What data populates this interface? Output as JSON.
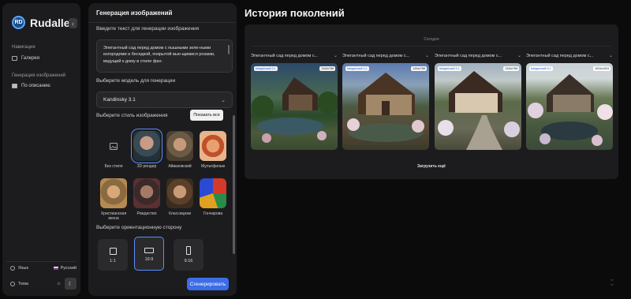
{
  "app": {
    "name": "Rudalle",
    "logo_letters": "RD"
  },
  "sidebar": {
    "collapse_icon": "chevron-left-icon",
    "nav_section": "Навигация",
    "nav_items": [
      {
        "label": "Галерея",
        "icon": "gallery-icon"
      }
    ],
    "gen_section": "Генерация изображений",
    "gen_items": [
      {
        "label": "По описанию",
        "icon": "text-image-icon",
        "active": true
      }
    ],
    "language_label": "Язык",
    "language_value": "Русский",
    "theme_label": "Тема"
  },
  "panel": {
    "title": "Генерация изображений",
    "prompt_label": "Введите текст для генерации изображения",
    "prompt_value": "Элегантный сад перед домом с пышными зеле-ными изгородями и беседкой, покрытой вью-щимися розами, ведущий к  дому в стиле фах-",
    "model_label": "Выберите модель для генерации",
    "model_value": "Kandinsky 3.1",
    "style_label": "Выберите стиль изображения",
    "show_all": "Показать все",
    "styles": [
      {
        "name": "Без стиля",
        "selected": false
      },
      {
        "name": "3D рендер",
        "selected": true
      },
      {
        "name": "Айвазовский",
        "selected": false
      },
      {
        "name": "Мультфильм",
        "selected": false
      },
      {
        "name": "Христианская икона",
        "selected": false
      },
      {
        "name": "Рождество",
        "selected": false
      },
      {
        "name": "Классицизм",
        "selected": false
      },
      {
        "name": "Гончарова",
        "selected": false
      }
    ],
    "orientation_label": "Выберите ориентационную сторону",
    "orientations": [
      {
        "ratio": "1:1",
        "selected": false
      },
      {
        "ratio": "16:9",
        "selected": true
      },
      {
        "ratio": "9:16",
        "selected": false
      }
    ],
    "generate": "Сгенерировать"
  },
  "history": {
    "title": "История поколений",
    "group_label": "Сегодня",
    "items": [
      {
        "caption": "Элегантный сад перед домом с...",
        "model": "Кандинский 3.1",
        "size": "1344x768"
      },
      {
        "caption": "Элегантный сад перед домом с...",
        "model": "Кандинский 3.1",
        "size": "1344x768"
      },
      {
        "caption": "Элегантный сад перед домом с...",
        "model": "Кандинский 3.1",
        "size": "1344x768"
      },
      {
        "caption": "Элегантный сад перед домом с...",
        "model": "Кандинский 3.1",
        "size": "1024x1024"
      }
    ],
    "load_more": "Загрузить ещё"
  },
  "colors": {
    "accent": "#3b6de8",
    "panel_bg": "#1c1c1e",
    "page_bg": "#0b0b0b"
  }
}
